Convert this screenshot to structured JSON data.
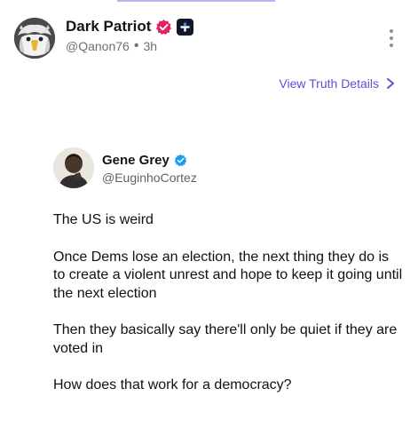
{
  "post": {
    "author": {
      "display_name": "Dark Patriot",
      "handle": "@Qanon76",
      "time_ago": "3h",
      "avatar_icon": "eagle-avatar",
      "verified_badge_color": "#e0245e"
    },
    "actions": {
      "more_icon": "vertical-ellipsis-icon",
      "view_details_label": "View Truth Details",
      "link_color": "#5a52d6"
    }
  },
  "quoted_post": {
    "author": {
      "display_name": "Gene Grey",
      "handle": "@EuginhoCortez",
      "verified_badge_color": "#1d9bf0"
    },
    "paragraphs": [
      "The US is weird",
      "Once Dems lose an election, the next thing they do is to create a violent unrest and hope to keep it going until the next election",
      "Then they basically say there'll only be quiet if they are voted in",
      "How does that work for a democracy?"
    ]
  }
}
